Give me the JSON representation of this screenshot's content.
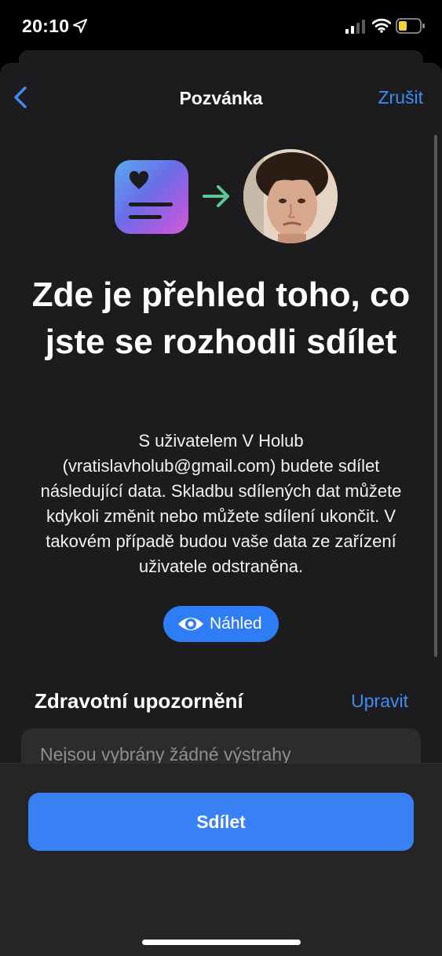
{
  "status_bar": {
    "time": "20:10",
    "icons": [
      "location-arrow-icon",
      "cellular-signal-icon",
      "wifi-icon",
      "battery-low-icon"
    ]
  },
  "nav": {
    "back_icon": "chevron-left-icon",
    "title": "Pozvánka",
    "cancel_label": "Zrušit"
  },
  "hero": {
    "app_icon": "health-sharing-icon",
    "arrow_icon": "arrow-right-icon",
    "avatar": "contact-photo"
  },
  "headline": "Zde je přehled toho, co jste se rozhodli sdílet",
  "description": "S uživatelem V Holub (vratislavholub@gmail.com) budete sdílet následující data. Skladbu sdílených dat můžete kdykoli změnit nebo můžete sdílení ukončit. V takovém případě budou vaše data ze zařízení uživatele odstraněna.",
  "preview_button": {
    "icon": "eye-icon",
    "label": "Náhled"
  },
  "health_alerts": {
    "title": "Zdravotní upozornění",
    "edit_label": "Upravit",
    "empty_text": "Nejsou vybrány žádné výstrahy"
  },
  "share_button": {
    "label": "Sdílet"
  },
  "colors": {
    "accent": "#3e8cf8",
    "button": "#3880f4",
    "background": "#1c1c1e",
    "arrow": "#5ec79a"
  }
}
